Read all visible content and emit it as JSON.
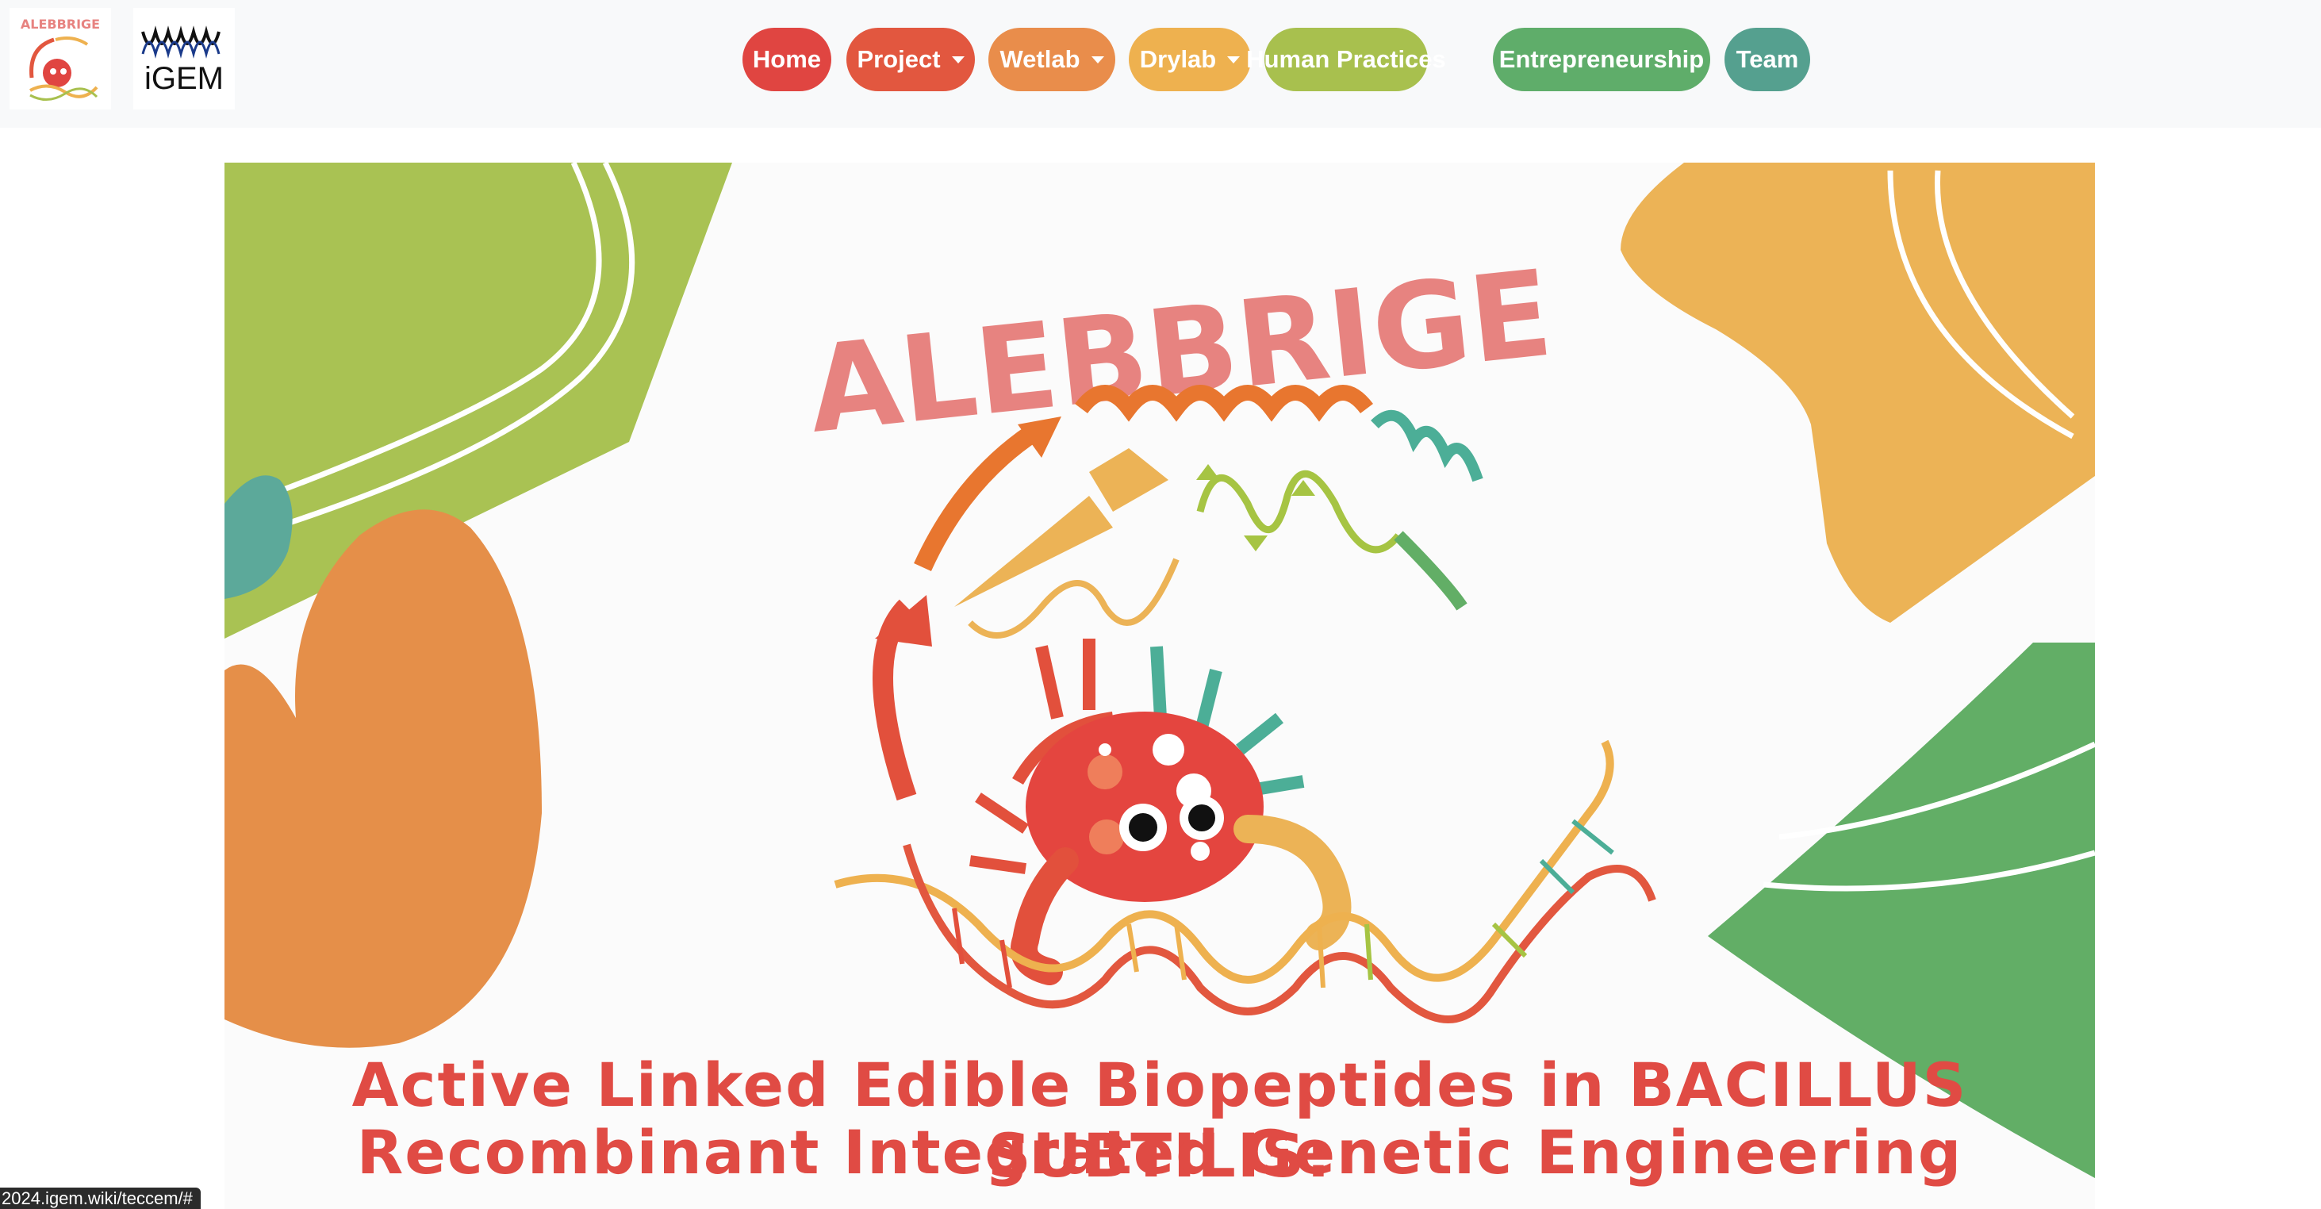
{
  "navbar": {
    "logos": {
      "team_logo_text": "ALEBBRIGE",
      "igem_logo_text": "iGEM"
    },
    "items": [
      {
        "label": "Home",
        "color": "#e04541",
        "dropdown": false
      },
      {
        "label": "Project",
        "color": "#e2573f",
        "dropdown": true
      },
      {
        "label": "Wetlab",
        "color": "#e98d4b",
        "dropdown": true
      },
      {
        "label": "Drylab",
        "color": "#eeb14f",
        "dropdown": true
      },
      {
        "label": "Human Practices",
        "color": "#a8c04e",
        "dropdown": false
      },
      {
        "label": "Entrepreneurship",
        "color": "#5fad6a",
        "dropdown": false
      },
      {
        "label": "Team",
        "color": "#55a08f",
        "dropdown": false
      }
    ]
  },
  "hero": {
    "logo_word": "ALEBBRIGE",
    "title_line1": "Active Linked Edible Biopeptides in BACILLUS SUBTILIS:",
    "title_line2": "Recombinant Integrated Genetic Engineering"
  },
  "colors": {
    "green": "#a9c253",
    "orange": "#e58f49",
    "yellow": "#ecb356",
    "dark_green": "#62ae66",
    "teal": "#5ca99a",
    "title_red": "#e04b44",
    "logo_pink": "#e78380"
  },
  "status_bar": {
    "url": "2024.igem.wiki/teccem/#"
  }
}
